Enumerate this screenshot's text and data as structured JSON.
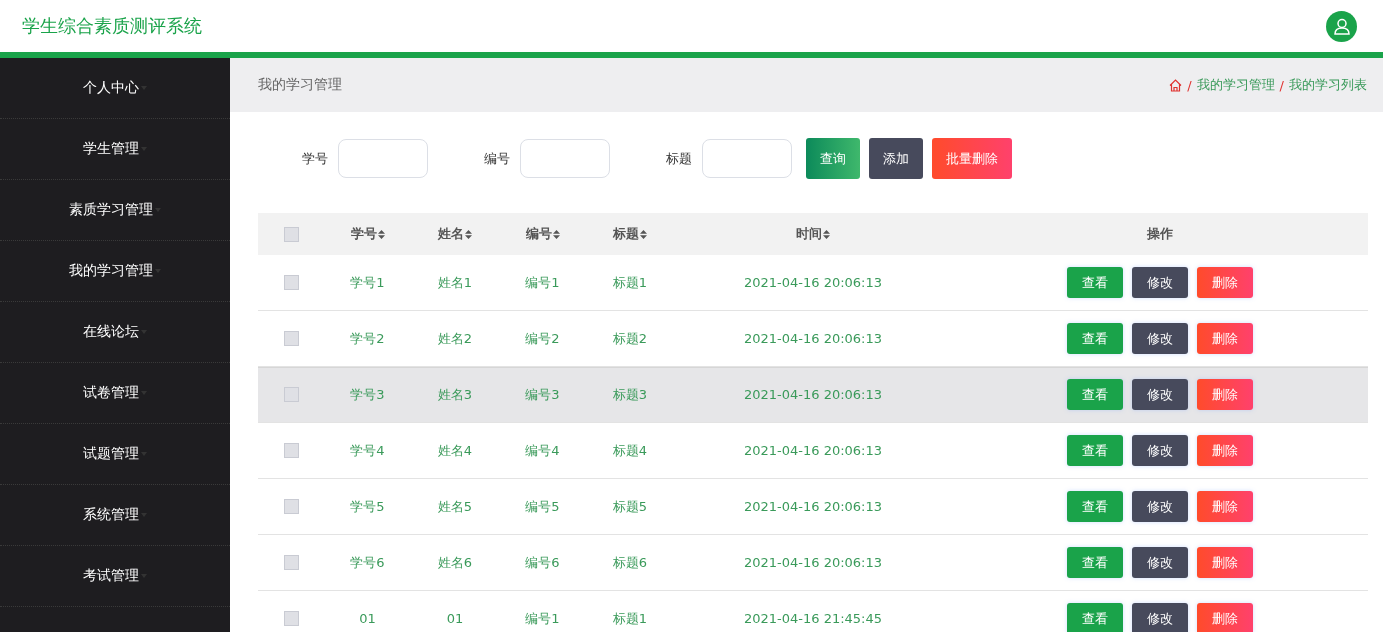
{
  "header": {
    "title": "学生综合素质测评系统"
  },
  "sidebar": {
    "items": [
      {
        "label": "个人中心"
      },
      {
        "label": "学生管理"
      },
      {
        "label": "素质学习管理"
      },
      {
        "label": "我的学习管理"
      },
      {
        "label": "在线论坛"
      },
      {
        "label": "试卷管理"
      },
      {
        "label": "试题管理"
      },
      {
        "label": "系统管理"
      },
      {
        "label": "考试管理"
      }
    ]
  },
  "page_title": "我的学习管理",
  "breadcrumb": {
    "separator": "/",
    "items": [
      "我的学习管理",
      "我的学习列表"
    ]
  },
  "filters": [
    {
      "label": "学号"
    },
    {
      "label": "编号"
    },
    {
      "label": "标题"
    }
  ],
  "filter_buttons": [
    {
      "label": "查询",
      "kind": "search"
    },
    {
      "label": "添加",
      "kind": "add"
    },
    {
      "label": "批量删除",
      "kind": "delete"
    }
  ],
  "table": {
    "select_all_checked": false,
    "columns": [
      {
        "label": "学号",
        "sortable": true
      },
      {
        "label": "姓名",
        "sortable": true
      },
      {
        "label": "编号",
        "sortable": true
      },
      {
        "label": "标题",
        "sortable": true
      },
      {
        "label": "时间",
        "sortable": true
      },
      {
        "label": "操作",
        "sortable": false
      }
    ],
    "rows": [
      {
        "checked": false,
        "highlighted": false,
        "cells": [
          "学号1",
          "姓名1",
          "编号1",
          "标题1",
          "2021-04-16 20:06:13"
        ],
        "actions": [
          {
            "label": "查看",
            "kind": "view"
          },
          {
            "label": "修改",
            "kind": "edit"
          },
          {
            "label": "删除",
            "kind": "delete"
          }
        ]
      },
      {
        "checked": false,
        "highlighted": false,
        "cells": [
          "学号2",
          "姓名2",
          "编号2",
          "标题2",
          "2021-04-16 20:06:13"
        ],
        "actions": [
          {
            "label": "查看",
            "kind": "view"
          },
          {
            "label": "修改",
            "kind": "edit"
          },
          {
            "label": "删除",
            "kind": "delete"
          }
        ]
      },
      {
        "checked": false,
        "highlighted": true,
        "cells": [
          "学号3",
          "姓名3",
          "编号3",
          "标题3",
          "2021-04-16 20:06:13"
        ],
        "actions": [
          {
            "label": "查看",
            "kind": "view"
          },
          {
            "label": "修改",
            "kind": "edit"
          },
          {
            "label": "删除",
            "kind": "delete"
          }
        ]
      },
      {
        "checked": false,
        "highlighted": false,
        "cells": [
          "学号4",
          "姓名4",
          "编号4",
          "标题4",
          "2021-04-16 20:06:13"
        ],
        "actions": [
          {
            "label": "查看",
            "kind": "view"
          },
          {
            "label": "修改",
            "kind": "edit"
          },
          {
            "label": "删除",
            "kind": "delete"
          }
        ]
      },
      {
        "checked": false,
        "highlighted": false,
        "cells": [
          "学号5",
          "姓名5",
          "编号5",
          "标题5",
          "2021-04-16 20:06:13"
        ],
        "actions": [
          {
            "label": "查看",
            "kind": "view"
          },
          {
            "label": "修改",
            "kind": "edit"
          },
          {
            "label": "删除",
            "kind": "delete"
          }
        ]
      },
      {
        "checked": false,
        "highlighted": false,
        "cells": [
          "学号6",
          "姓名6",
          "编号6",
          "标题6",
          "2021-04-16 20:06:13"
        ],
        "actions": [
          {
            "label": "查看",
            "kind": "view"
          },
          {
            "label": "修改",
            "kind": "edit"
          },
          {
            "label": "删除",
            "kind": "delete"
          }
        ]
      },
      {
        "checked": false,
        "highlighted": false,
        "cells": [
          "01",
          "01",
          "编号1",
          "标题1",
          "2021-04-16 21:45:45"
        ],
        "actions": [
          {
            "label": "查看",
            "kind": "view"
          },
          {
            "label": "修改",
            "kind": "edit"
          },
          {
            "label": "删除",
            "kind": "delete"
          }
        ]
      }
    ]
  }
}
